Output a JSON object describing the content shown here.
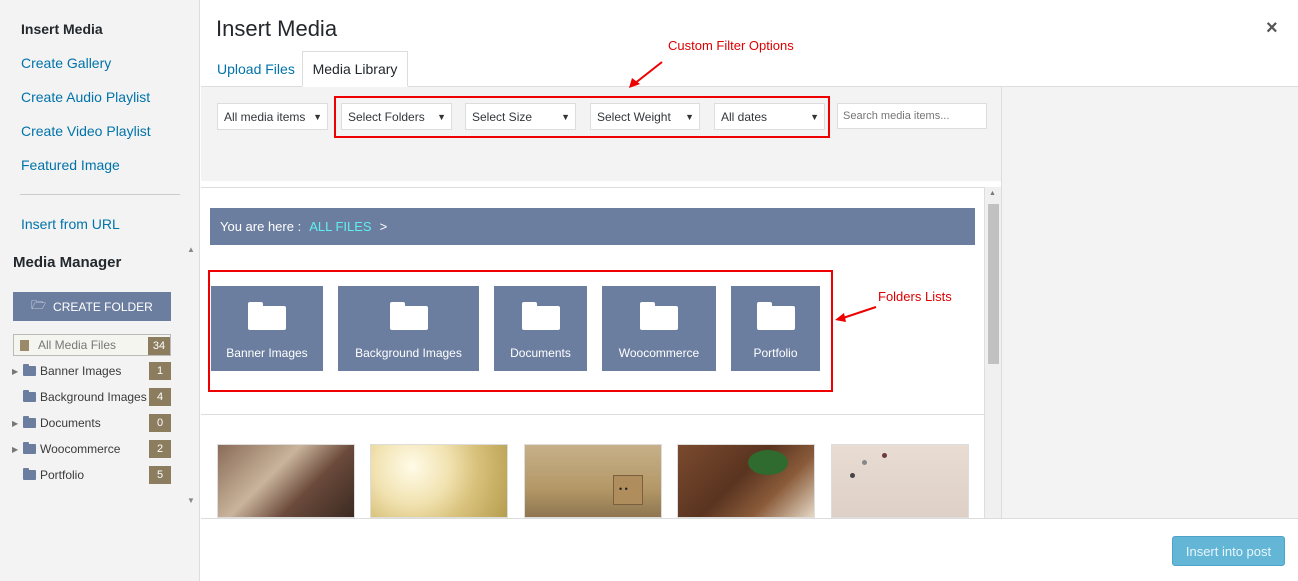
{
  "sidebar": {
    "title": "Insert Media",
    "links": [
      "Create Gallery",
      "Create Audio Playlist",
      "Create Video Playlist",
      "Featured Image"
    ],
    "insert_url": "Insert from URL",
    "media_manager_title": "Media Manager",
    "create_folder_label": "CREATE FOLDER",
    "tree": [
      {
        "label": "All Media Files",
        "count": "34"
      },
      {
        "label": "Banner Images",
        "count": "1"
      },
      {
        "label": "Background Images",
        "count": "4"
      },
      {
        "label": "Documents",
        "count": "0"
      },
      {
        "label": "Woocommerce",
        "count": "2"
      },
      {
        "label": "Portfolio",
        "count": "5"
      }
    ]
  },
  "header": {
    "title": "Insert Media",
    "close_icon": "×",
    "tabs": [
      {
        "label": "Upload Files"
      },
      {
        "label": "Media Library",
        "active": true
      }
    ]
  },
  "filters": {
    "media_type": "All media items",
    "folders": "Select Folders",
    "size": "Select Size",
    "weight": "Select Weight",
    "dates": "All dates",
    "search_placeholder": "Search media items..."
  },
  "annotations": {
    "filter": "Custom Filter Options",
    "folders": "Folders Lists"
  },
  "breadcrumb": {
    "prefix": "You are here :",
    "link": "ALL FILES",
    "separator": ">"
  },
  "folder_tiles": [
    "Banner Images",
    "Background Images",
    "Documents",
    "Woocommerce",
    "Portfolio"
  ],
  "footer": {
    "insert_label": "Insert into post"
  },
  "colors": {
    "accent": "#6c7ea0",
    "link": "#0073aa",
    "annotation": "#e00000",
    "count_badge": "#8b7d5e",
    "insert_button": "#63b6d6"
  }
}
